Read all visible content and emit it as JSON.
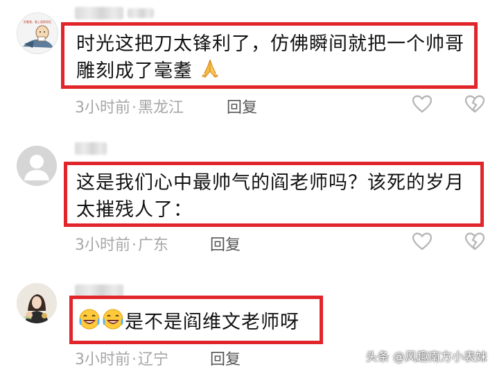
{
  "comments": [
    {
      "text_line1": "时光这把刀太锋利了，仿佛瞬间就把一个帅哥",
      "text_line2": "雕刻成了毫耋",
      "time": "3小时前",
      "location": "黑龙江",
      "reply_label": "回复",
      "trailing_emoji": "folded-hands"
    },
    {
      "text_line1": "这是我们心中最帅气的阎老师吗？该死的岁月",
      "text_line2": "太摧残人了：",
      "time": "3小时前",
      "location": "广东",
      "reply_label": "回复"
    },
    {
      "text_line1": "是不是阎维文老师呀",
      "time": "3小时前",
      "location": "辽宁",
      "reply_label": "回复",
      "leading_emojis": [
        "laughing-crying",
        "laughing-crying"
      ]
    }
  ],
  "separator": "·",
  "avatar_1_text": "别看我，看上面那段话",
  "watermark": "头条 @风趣南方小表妹",
  "colors": {
    "highlight_border": "#e0262b",
    "meta_text": "#a6a6a6",
    "icon_stroke": "#b8b8b8"
  },
  "icons": [
    "like-heart-icon",
    "dislike-broken-heart-icon"
  ]
}
